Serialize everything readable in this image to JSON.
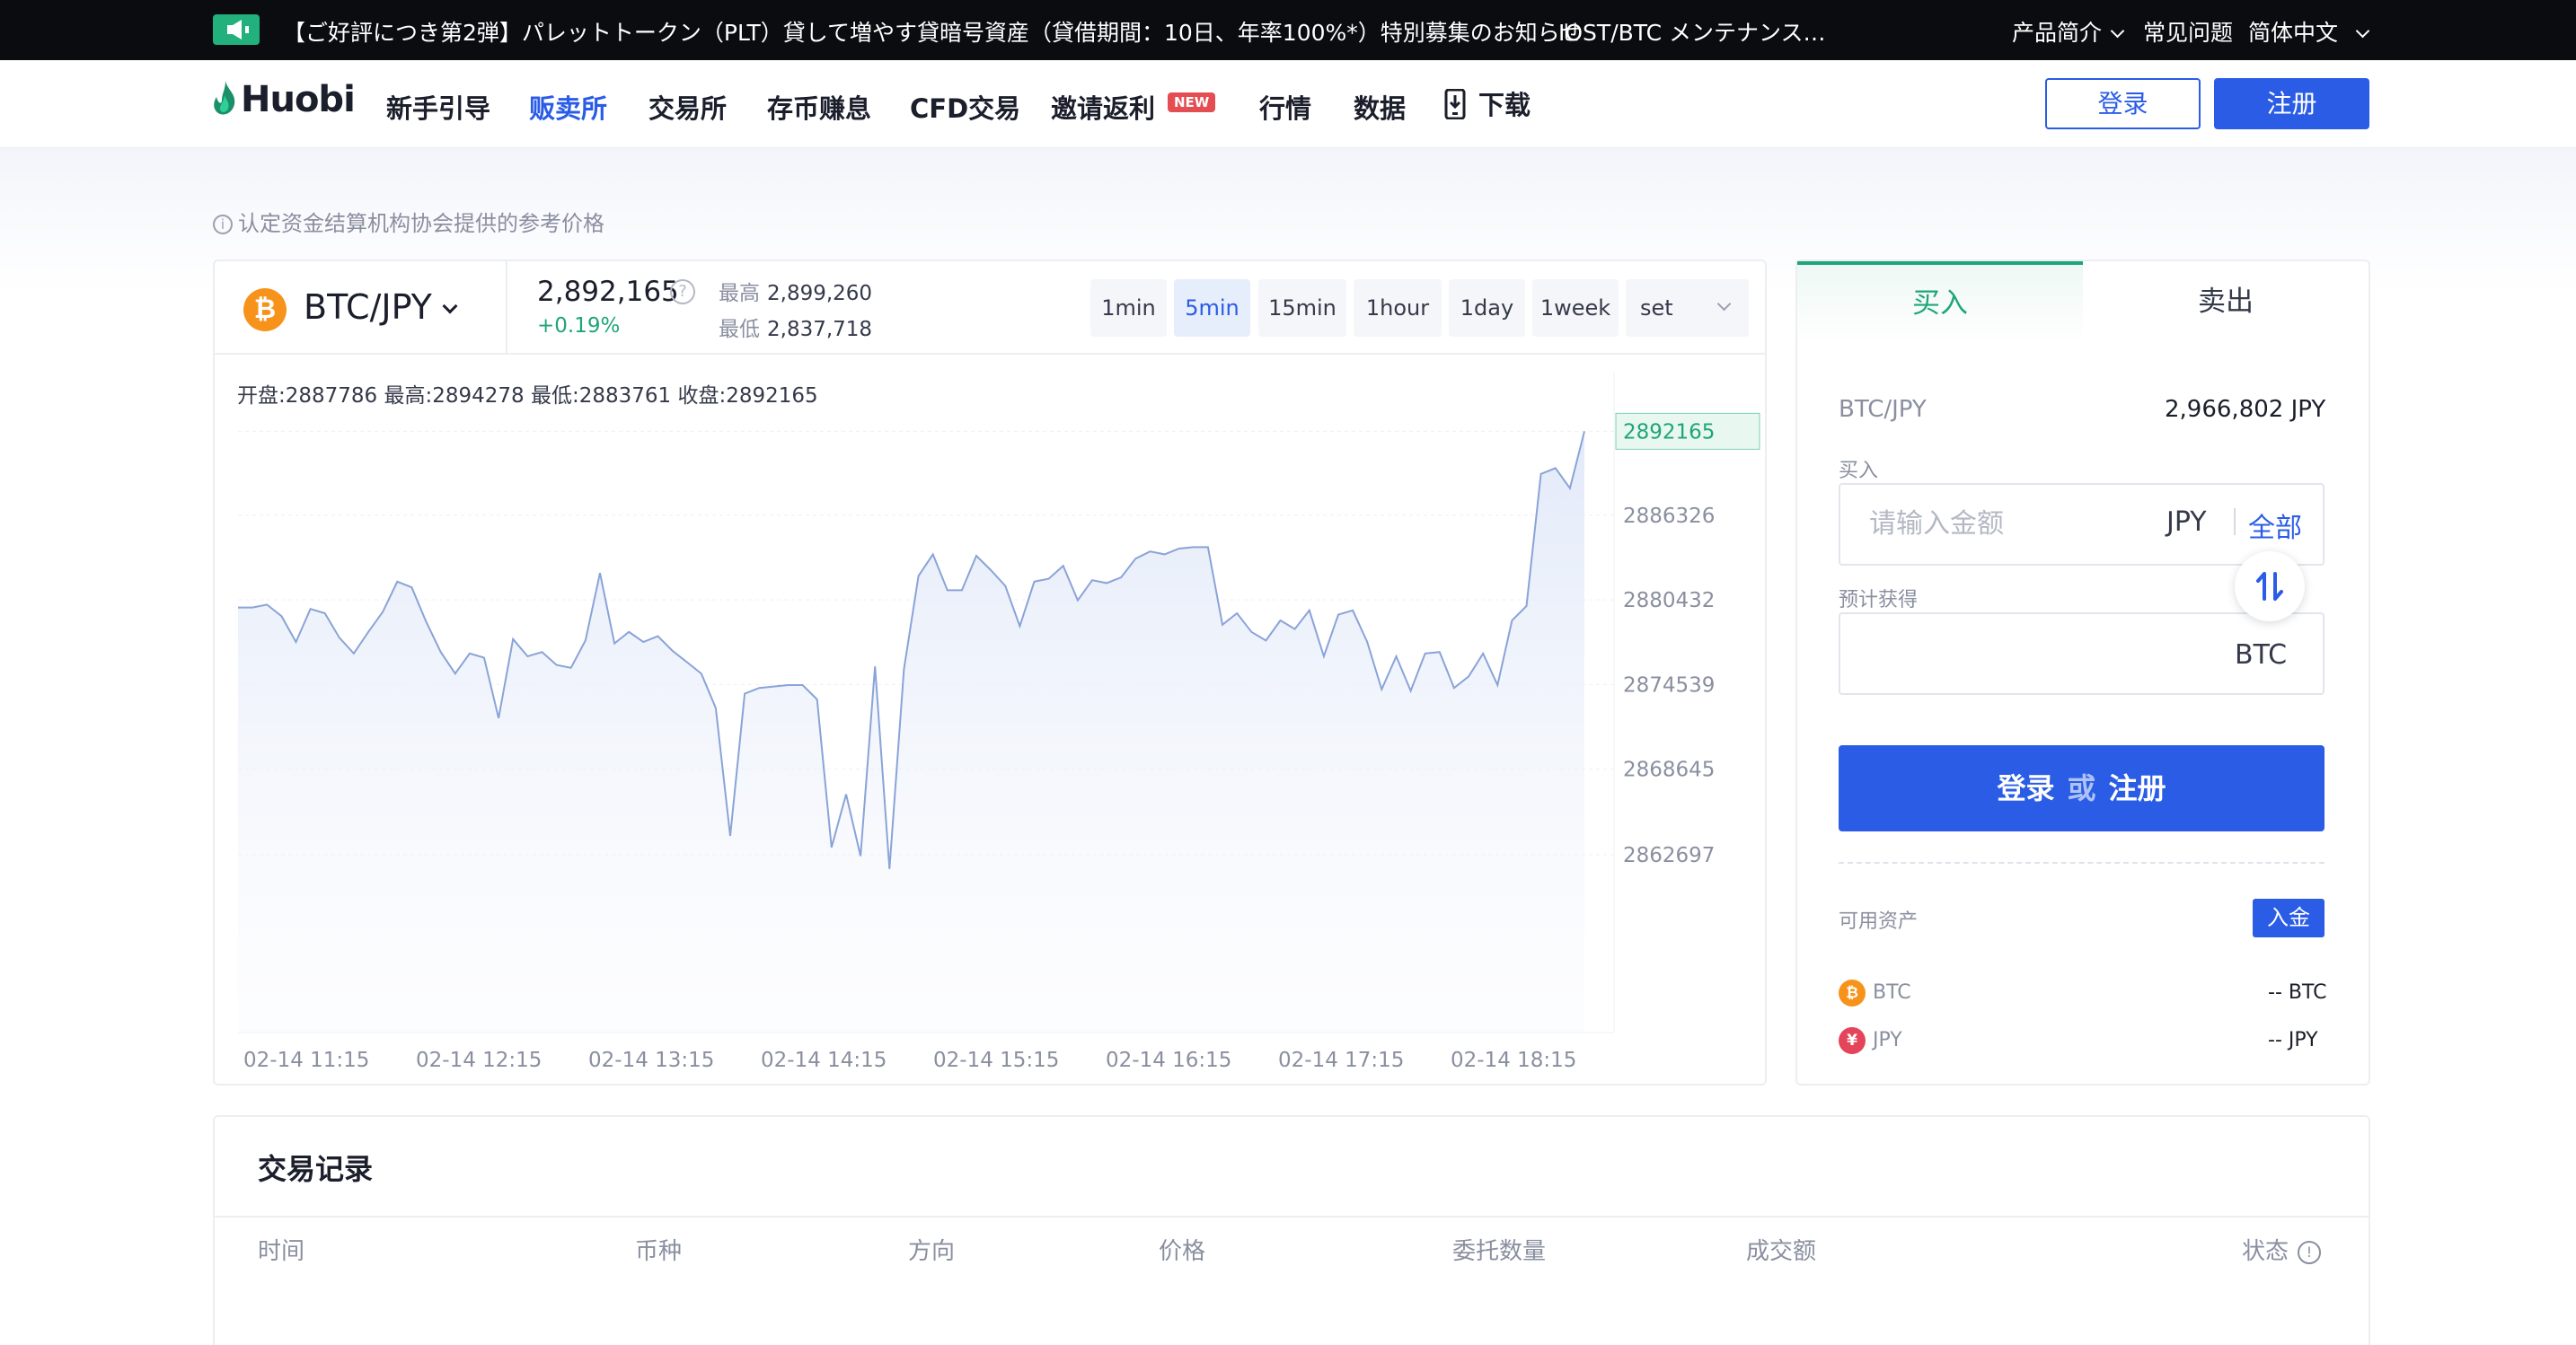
{
  "announcement": {
    "text": "【ご好評につき第2弾】パレットトークン（PLT）貸して増やす貸暗号資産（貸借期間：10日、年率100%*）特別募集のお知らせ",
    "text2": "IOST/BTC メンテナンスの..."
  },
  "topnav": {
    "products": "产品简介",
    "faq": "常见问题",
    "language": "简体中文"
  },
  "logo": {
    "text": "Huobi"
  },
  "nav": {
    "items": [
      {
        "label": "新手引导"
      },
      {
        "label": "贩卖所"
      },
      {
        "label": "交易所"
      },
      {
        "label": "存币赚息"
      },
      {
        "label": "CFD交易"
      },
      {
        "label": "邀请返利"
      },
      {
        "label": "行情"
      },
      {
        "label": "数据"
      },
      {
        "label": "下载"
      }
    ],
    "new_badge": "NEW",
    "login": "登录",
    "register": "注册"
  },
  "notice": "认定资金结算机构协会提供的参考价格",
  "market": {
    "pair": "BTC/JPY",
    "price": "2,892,165",
    "change": "+0.19%",
    "high_label": "最高",
    "high": "2,899,260",
    "low_label": "最低",
    "low": "2,837,718",
    "timeframes": [
      "1min",
      "5min",
      "15min",
      "1hour",
      "1day",
      "1week"
    ],
    "set_label": "set",
    "ohlc": "开盘:2887786  最高:2894278  最低:2883761  收盘:2892165"
  },
  "chart_data": {
    "type": "area",
    "x_ticks": [
      "02-14 11:15",
      "02-14 12:15",
      "02-14 13:15",
      "02-14 14:15",
      "02-14 15:15",
      "02-14 16:15",
      "02-14 17:15",
      "02-14 18:15"
    ],
    "y_ticks": [
      "2892165",
      "2886326",
      "2880432",
      "2874539",
      "2868645",
      "2862697"
    ],
    "current_price_label": "2892165",
    "ylim": [
      2858000,
      2895000
    ],
    "values": [
      2879900,
      2879900,
      2880100,
      2879300,
      2877500,
      2879800,
      2879500,
      2877800,
      2876700,
      2878200,
      2879600,
      2881700,
      2881300,
      2878900,
      2876800,
      2875300,
      2876700,
      2876400,
      2872200,
      2877700,
      2876500,
      2876800,
      2875900,
      2875700,
      2877600,
      2882300,
      2877400,
      2878200,
      2877500,
      2877900,
      2876900,
      2876100,
      2875300,
      2872900,
      2864000,
      2873900,
      2874300,
      2874400,
      2874500,
      2874500,
      2873500,
      2863200,
      2866900,
      2862600,
      2875800,
      2861700,
      2875600,
      2882100,
      2883600,
      2881100,
      2881100,
      2883500,
      2882500,
      2881400,
      2878600,
      2881700,
      2881900,
      2882800,
      2880400,
      2881800,
      2881600,
      2882000,
      2883300,
      2883800,
      2883600,
      2884000,
      2884100,
      2884100,
      2878700,
      2879500,
      2878200,
      2877600,
      2879000,
      2878400,
      2879700,
      2876500,
      2879400,
      2879700,
      2877500,
      2874200,
      2876500,
      2874100,
      2876700,
      2876800,
      2874300,
      2875100,
      2876700,
      2874500,
      2879000,
      2880000,
      2889200,
      2889600,
      2888200,
      2892165
    ]
  },
  "trade": {
    "tab_buy": "买入",
    "tab_sell": "卖出",
    "pair": "BTC/JPY",
    "quote": "2,966,802 JPY",
    "buy_label": "买入",
    "amount_placeholder": "请输入金额",
    "unit_jpy": "JPY",
    "all": "全部",
    "estimate_label": "预计获得",
    "unit_btc": "BTC",
    "cta_login": "登录",
    "cta_or": "或",
    "cta_register": "注册",
    "available_label": "可用资产",
    "deposit": "入金",
    "assets": [
      {
        "coin": "BTC",
        "value": "-- BTC",
        "symbol": "₿"
      },
      {
        "coin": "JPY",
        "value": "-- JPY",
        "symbol": "¥"
      }
    ]
  },
  "records": {
    "title": "交易记录",
    "columns": [
      "时间",
      "币种",
      "方向",
      "价格",
      "委托数量",
      "成交额",
      "状态"
    ]
  },
  "colors": {
    "brand_blue": "#2a5ce6",
    "up_green": "#1fa57a",
    "chart_line": "#8aa3d8"
  }
}
